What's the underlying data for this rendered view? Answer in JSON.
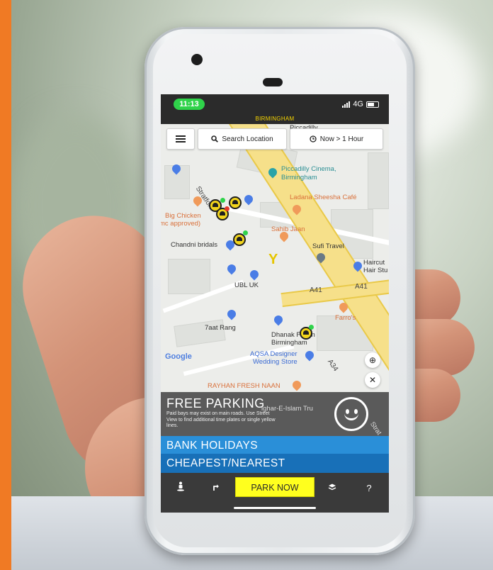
{
  "status": {
    "time": "11:13",
    "network": "4G",
    "city": "BIRMINGHAM"
  },
  "map_controls": {
    "search_label": "Search Location",
    "time_label": "Now > 1 Hour"
  },
  "map_labels": {
    "piccadilly_top": "Piccadilly",
    "piccadilly_cinema_1": "Piccadilly Cinema,",
    "piccadilly_cinema_2": "Birmingham",
    "ladana": "Ladana Sheesha Café",
    "stratford": "Stratford",
    "big_chicken_1": "Big Chicken",
    "big_chicken_2": "mc approved)",
    "sahib_jaan": "Sahib Jaan",
    "sufi_travel": "Sufi Travel",
    "chandni": "Chandni bridals",
    "haircut_1": "Haircut",
    "haircut_2": "Hair Stu",
    "ubl": "UBL UK",
    "a41_left": "A41",
    "a41_right": "A41",
    "farros": "Farro's",
    "aat_rang": "7aat Rang",
    "dhanak_1": "Dhanak F  hion",
    "dhanak_2": "Birmingham",
    "google": "Google",
    "aqsa_1": "AQSA Designer",
    "aqsa_2": "Wedding Store",
    "a34": "A34",
    "rayhan": "RAYHAN FRESH NAAN",
    "islam_tru": "ighar-E-Islam Tru",
    "strat_bottom": "Strat"
  },
  "free_parking": {
    "title": "FREE PARKING",
    "description": "Paid bays may exist on main roads. Use Street View to find additional time plates or single yellow lines."
  },
  "bands": {
    "holidays": "BANK HOLIDAYS",
    "cheapest": "CHEAPEST/NEAREST"
  },
  "toolbar": {
    "park_now": "PARK NOW",
    "help": "?"
  },
  "icons": {
    "menu": "hamburger-icon",
    "search": "search-icon",
    "clock": "clock-icon",
    "locate": "locate-icon",
    "close": "close-icon",
    "street_view": "person-icon",
    "directions": "turn-right-icon",
    "layers": "layers-icon",
    "smiley": "smiley-icon"
  },
  "colors": {
    "background": "#f07a24",
    "status_time": "#2fd34a",
    "holidays_band": "#2a8fd8",
    "cheapest_band": "#1870b8",
    "park_now": "#ffff1e",
    "marker_yellow": "#f2d51c"
  }
}
